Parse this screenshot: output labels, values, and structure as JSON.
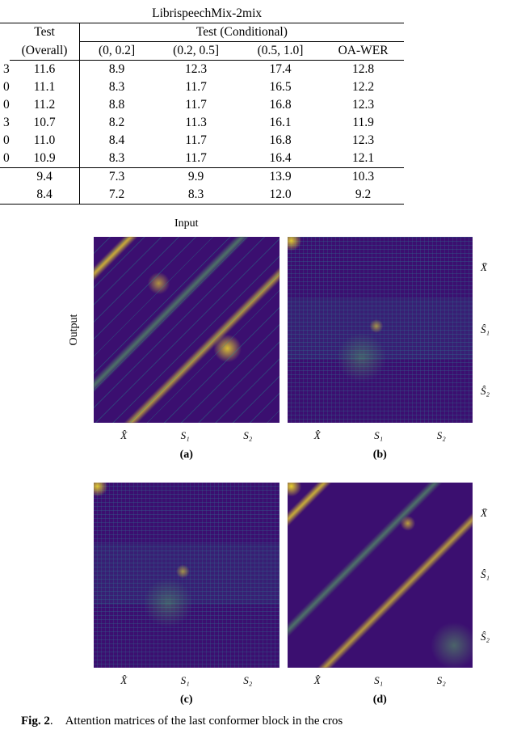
{
  "table": {
    "title": "LibrispeechMix-2mix",
    "head": {
      "test_overall_l1": "Test",
      "test_overall_l2": "(Overall)",
      "test_cond": "Test (Conditional)",
      "bucket1": "(0, 0.2]",
      "bucket2": "(0.2, 0.5]",
      "bucket3": "(0.5, 1.0]",
      "oa": "OA-WER"
    },
    "rows": [
      {
        "left": "3",
        "ov": "11.6",
        "b1": "8.9",
        "b2": "12.3",
        "b3": "17.4",
        "oa": "12.8",
        "bold": false
      },
      {
        "left": "0",
        "ov": "11.1",
        "b1": "8.3",
        "b2": "11.7",
        "b3": "16.5",
        "oa": "12.2",
        "bold": true
      },
      {
        "left": "0",
        "ov": "11.2",
        "b1": "8.8",
        "b2": "11.7",
        "b3": "16.8",
        "oa": "12.3",
        "bold": false
      },
      {
        "left": "3",
        "ov": "10.7",
        "b1": "8.2",
        "b2": "11.3",
        "b3": "16.1",
        "oa": "11.9",
        "bold": true
      },
      {
        "left": "0",
        "ov": "11.0",
        "b1": "8.4",
        "b2": "11.7",
        "b3": "16.8",
        "oa": "12.3",
        "bold": false
      },
      {
        "left": "0",
        "ov": "10.9",
        "b1": "8.3",
        "b2": "11.7",
        "b3": "16.4",
        "oa": "12.1",
        "bold": false
      },
      {
        "left": "",
        "ov": "9.4",
        "b1": "7.3",
        "b2": "9.9",
        "b3": "13.9",
        "oa": "10.3",
        "bold": false
      },
      {
        "left": "",
        "ov": "8.4",
        "b1": "7.2",
        "b2": "8.3",
        "b3": "12.0",
        "oa": "9.2",
        "bold": true
      }
    ],
    "separators_after": [
      5
    ]
  },
  "figure": {
    "input_label": "Input",
    "output_label": "Output",
    "y_ticks": [
      "X̄",
      "Ŝ₁",
      "Ŝ₂"
    ],
    "x_ticks": [
      "X̂",
      "S₁",
      "S₂"
    ],
    "panels": [
      "(a)",
      "(b)",
      "(c)",
      "(d)"
    ]
  },
  "caption": {
    "label": "Fig. 2",
    "text": ". Attention matrices of the last conformer block in the cros"
  }
}
